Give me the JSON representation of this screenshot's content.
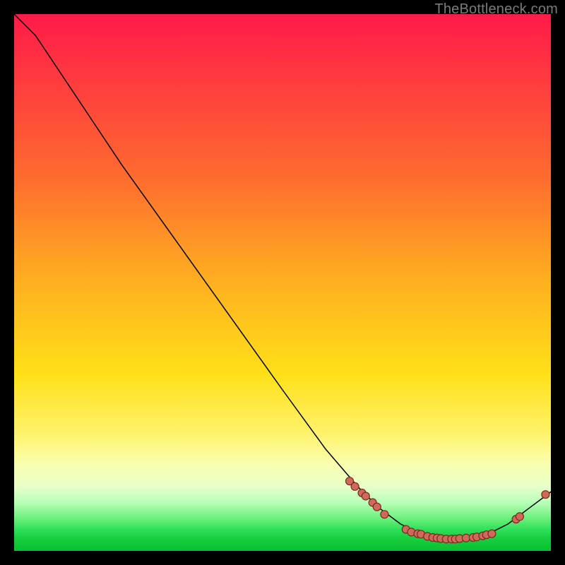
{
  "watermark": "TheBottleneck.com",
  "chart_data": {
    "type": "line",
    "title": "",
    "xlabel": "",
    "ylabel": "",
    "xlim": [
      0,
      100
    ],
    "ylim": [
      0,
      100
    ],
    "grid": false,
    "curve": [
      {
        "x": 0,
        "y": 100
      },
      {
        "x": 4,
        "y": 96
      },
      {
        "x": 8,
        "y": 90
      },
      {
        "x": 12,
        "y": 84
      },
      {
        "x": 20,
        "y": 72
      },
      {
        "x": 30,
        "y": 58
      },
      {
        "x": 40,
        "y": 44
      },
      {
        "x": 50,
        "y": 30
      },
      {
        "x": 58,
        "y": 19
      },
      {
        "x": 64,
        "y": 12
      },
      {
        "x": 68,
        "y": 8
      },
      {
        "x": 72,
        "y": 5
      },
      {
        "x": 76,
        "y": 3
      },
      {
        "x": 80,
        "y": 2
      },
      {
        "x": 84,
        "y": 2
      },
      {
        "x": 88,
        "y": 3
      },
      {
        "x": 92,
        "y": 5
      },
      {
        "x": 96,
        "y": 8
      },
      {
        "x": 100,
        "y": 11
      }
    ],
    "points": [
      {
        "x": 62.5,
        "y": 13.0
      },
      {
        "x": 63.5,
        "y": 12.0
      },
      {
        "x": 64.8,
        "y": 10.8
      },
      {
        "x": 65.5,
        "y": 10.2
      },
      {
        "x": 66.8,
        "y": 9.0
      },
      {
        "x": 67.6,
        "y": 8.2
      },
      {
        "x": 69.0,
        "y": 6.8
      },
      {
        "x": 73.0,
        "y": 4.0
      },
      {
        "x": 74.0,
        "y": 3.5
      },
      {
        "x": 75.2,
        "y": 3.2
      },
      {
        "x": 75.8,
        "y": 3.1
      },
      {
        "x": 77.0,
        "y": 2.7
      },
      {
        "x": 78.0,
        "y": 2.5
      },
      {
        "x": 78.8,
        "y": 2.4
      },
      {
        "x": 79.5,
        "y": 2.3
      },
      {
        "x": 80.5,
        "y": 2.2
      },
      {
        "x": 81.5,
        "y": 2.2
      },
      {
        "x": 82.2,
        "y": 2.2
      },
      {
        "x": 83.0,
        "y": 2.3
      },
      {
        "x": 84.2,
        "y": 2.4
      },
      {
        "x": 85.5,
        "y": 2.5
      },
      {
        "x": 86.2,
        "y": 2.6
      },
      {
        "x": 87.3,
        "y": 2.8
      },
      {
        "x": 88.0,
        "y": 3.0
      },
      {
        "x": 89.0,
        "y": 3.2
      },
      {
        "x": 93.5,
        "y": 5.9
      },
      {
        "x": 94.2,
        "y": 6.4
      },
      {
        "x": 99.0,
        "y": 10.5
      }
    ],
    "colors": {
      "line": "#000000",
      "point_fill": "#cf6a5a",
      "point_stroke": "#7a2a20",
      "gradient_top": "#ff1a4a",
      "gradient_mid": "#ffe018",
      "gradient_bottom": "#0abf30"
    }
  }
}
